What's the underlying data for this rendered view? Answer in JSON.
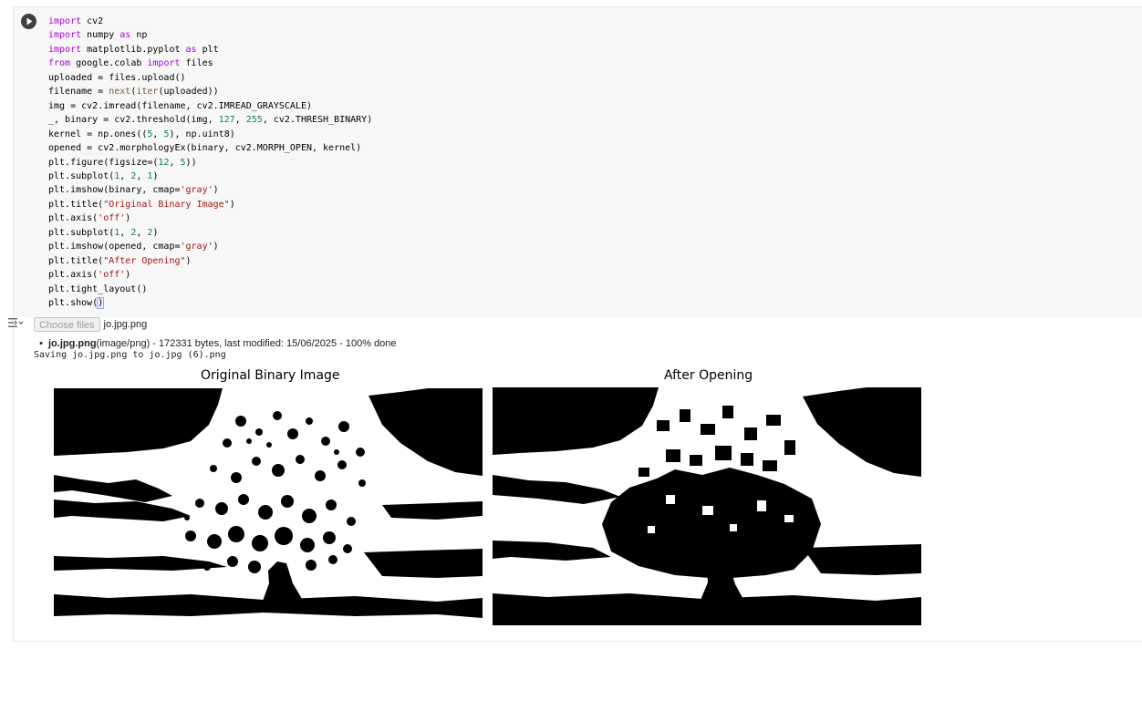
{
  "code_cell": {
    "lines": [
      "import cv2",
      "import numpy as np",
      "import matplotlib.pyplot as plt",
      "from google.colab import files",
      "uploaded = files.upload()",
      "filename = next(iter(uploaded))",
      "img = cv2.imread(filename, cv2.IMREAD_GRAYSCALE)",
      "_, binary = cv2.threshold(img, 127, 255, cv2.THRESH_BINARY)",
      "kernel = np.ones((5, 5), np.uint8)",
      "opened = cv2.morphologyEx(binary, cv2.MORPH_OPEN, kernel)",
      "plt.figure(figsize=(12, 5))",
      "plt.subplot(1, 2, 1)",
      "plt.imshow(binary, cmap='gray')",
      "plt.title(\"Original Binary Image\")",
      "plt.axis('off')",
      "plt.subplot(1, 2, 2)",
      "plt.imshow(opened, cmap='gray')",
      "plt.title(\"After Opening\")",
      "plt.axis('off')",
      "plt.tight_layout()",
      "plt.show()"
    ],
    "run_icon": "play-icon"
  },
  "output": {
    "toggle_icon": "output-toggle-icon",
    "choose_files_label": "Choose files",
    "selected_file": "jo.jpg.png",
    "file_entry_name": "jo.jpg.png",
    "file_entry_details": "(image/png) - 172331 bytes, last modified: 15/06/2025 - 100% done",
    "saving_message": "Saving jo.jpg.png to jo.jpg (6).png",
    "plots": [
      {
        "title": "Original Binary Image"
      },
      {
        "title": "After Opening"
      }
    ]
  }
}
